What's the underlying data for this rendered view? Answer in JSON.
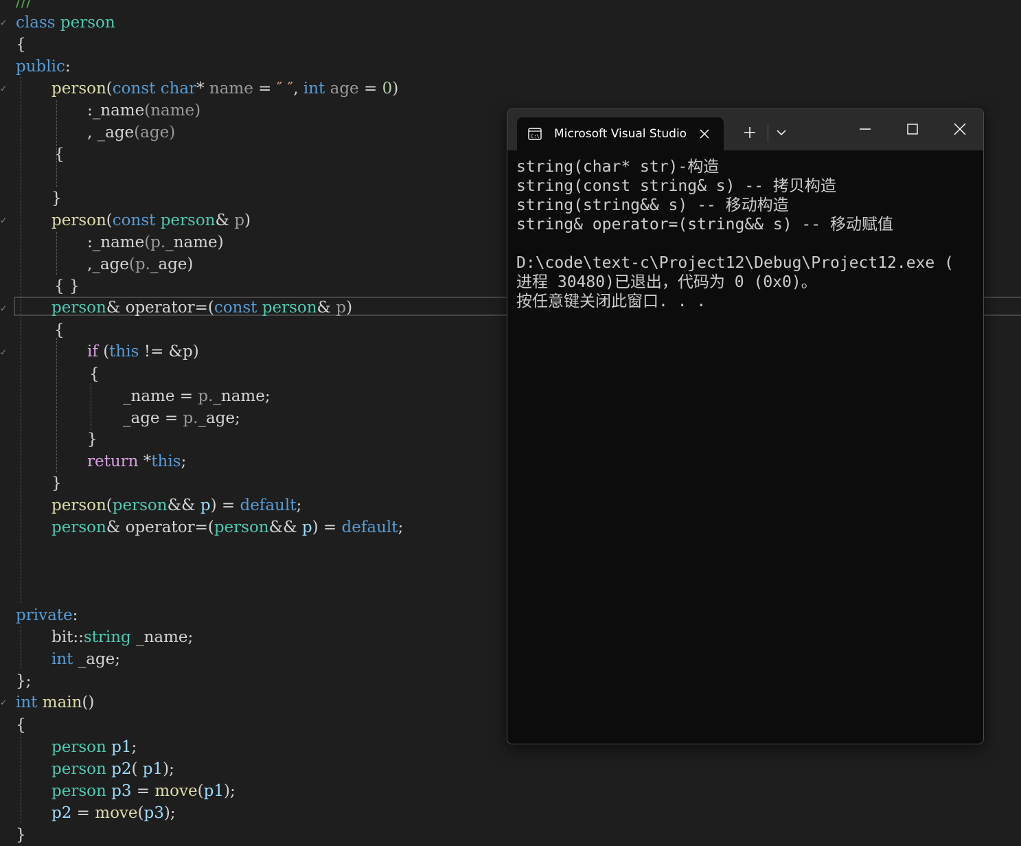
{
  "editor": {
    "lines": [
      [
        {
          "t": "///",
          "c": "cmt"
        }
      ],
      [
        {
          "t": "class ",
          "c": "kw"
        },
        {
          "t": "person",
          "c": "typ"
        }
      ],
      [
        {
          "t": "{",
          "c": "pl"
        }
      ],
      [
        {
          "t": "public",
          "c": "kw"
        },
        {
          "t": ":",
          "c": "pl"
        }
      ],
      [
        {
          "t": "person",
          "c": "fn"
        },
        {
          "t": "(",
          "c": "pl"
        },
        {
          "t": "const ",
          "c": "kw"
        },
        {
          "t": "char",
          "c": "kw"
        },
        {
          "t": "* ",
          "c": "pl"
        },
        {
          "t": "name",
          "c": "prm"
        },
        {
          "t": " = ",
          "c": "pl"
        },
        {
          "t": "″ ″",
          "c": "str"
        },
        {
          "t": ", ",
          "c": "pl"
        },
        {
          "t": "int ",
          "c": "kw"
        },
        {
          "t": "age",
          "c": "prm"
        },
        {
          "t": " = ",
          "c": "pl"
        },
        {
          "t": "0",
          "c": "num"
        },
        {
          "t": ")",
          "c": "pl"
        }
      ],
      [
        {
          "t": ":",
          "c": "pl"
        },
        {
          "t": "_name",
          "c": "pl"
        },
        {
          "t": "(",
          "c": "prm"
        },
        {
          "t": "name",
          "c": "prm"
        },
        {
          "t": ")",
          "c": "prm"
        }
      ],
      [
        {
          "t": ", ",
          "c": "pl"
        },
        {
          "t": "_age",
          "c": "pl"
        },
        {
          "t": "(age)",
          "c": "prm"
        }
      ],
      [
        {
          "t": "{",
          "c": "pl"
        }
      ],
      [],
      [
        {
          "t": "}",
          "c": "pl"
        }
      ],
      [
        {
          "t": "person",
          "c": "fn"
        },
        {
          "t": "(",
          "c": "pl"
        },
        {
          "t": "const ",
          "c": "kw"
        },
        {
          "t": "person",
          "c": "typ"
        },
        {
          "t": "& ",
          "c": "pl"
        },
        {
          "t": "p",
          "c": "prm"
        },
        {
          "t": ")",
          "c": "pl"
        }
      ],
      [
        {
          "t": ":",
          "c": "pl"
        },
        {
          "t": "_name",
          "c": "pl"
        },
        {
          "t": "(p.",
          "c": "prm"
        },
        {
          "t": "_name",
          "c": "pl"
        },
        {
          "t": ")",
          "c": "pl"
        }
      ],
      [
        {
          "t": ",",
          "c": "pl"
        },
        {
          "t": "_age",
          "c": "pl"
        },
        {
          "t": "(p.",
          "c": "prm"
        },
        {
          "t": "_age",
          "c": "pl"
        },
        {
          "t": ")",
          "c": "pl"
        }
      ],
      [
        {
          "t": "{ }",
          "c": "pl"
        }
      ],
      [
        {
          "t": "person",
          "c": "typ"
        },
        {
          "t": "& ",
          "c": "pl"
        },
        {
          "t": "operator=",
          "c": "pl"
        },
        {
          "t": "(",
          "c": "pl"
        },
        {
          "t": "const ",
          "c": "kw"
        },
        {
          "t": "person",
          "c": "typ"
        },
        {
          "t": "& ",
          "c": "pl"
        },
        {
          "t": "p",
          "c": "prm"
        },
        {
          "t": ")",
          "c": "pl"
        }
      ],
      [
        {
          "t": "{",
          "c": "pl"
        }
      ],
      [
        {
          "t": "if ",
          "c": "ctl"
        },
        {
          "t": "(",
          "c": "pl"
        },
        {
          "t": "this",
          "c": "kw"
        },
        {
          "t": " != &p)",
          "c": "pl"
        }
      ],
      [
        {
          "t": "{",
          "c": "pl"
        }
      ],
      [
        {
          "t": "_name",
          "c": "pl"
        },
        {
          "t": " = ",
          "c": "pl"
        },
        {
          "t": "p.",
          "c": "prm"
        },
        {
          "t": "_name",
          "c": "pl"
        },
        {
          "t": ";",
          "c": "pl"
        }
      ],
      [
        {
          "t": "_age",
          "c": "pl"
        },
        {
          "t": " = ",
          "c": "pl"
        },
        {
          "t": "p.",
          "c": "prm"
        },
        {
          "t": "_age",
          "c": "pl"
        },
        {
          "t": ";",
          "c": "pl"
        }
      ],
      [
        {
          "t": "}",
          "c": "pl"
        }
      ],
      [
        {
          "t": "return ",
          "c": "ctl"
        },
        {
          "t": "*",
          "c": "pl"
        },
        {
          "t": "this",
          "c": "kw"
        },
        {
          "t": ";",
          "c": "pl"
        }
      ],
      [
        {
          "t": "}",
          "c": "pl"
        }
      ],
      [
        {
          "t": "person",
          "c": "fn"
        },
        {
          "t": "(",
          "c": "pl"
        },
        {
          "t": "person",
          "c": "typ"
        },
        {
          "t": "&& ",
          "c": "pl"
        },
        {
          "t": "p",
          "c": "var"
        },
        {
          "t": ")",
          "c": "pl"
        },
        {
          "t": " = ",
          "c": "pl"
        },
        {
          "t": "default",
          "c": "kw"
        },
        {
          "t": ";",
          "c": "pl"
        }
      ],
      [
        {
          "t": "person",
          "c": "typ"
        },
        {
          "t": "& ",
          "c": "pl"
        },
        {
          "t": "operator=",
          "c": "pl"
        },
        {
          "t": "(",
          "c": "pl"
        },
        {
          "t": "person",
          "c": "typ"
        },
        {
          "t": "&& ",
          "c": "pl"
        },
        {
          "t": "p",
          "c": "var"
        },
        {
          "t": ")",
          "c": "pl"
        },
        {
          "t": " = ",
          "c": "pl"
        },
        {
          "t": "default",
          "c": "kw"
        },
        {
          "t": ";",
          "c": "pl"
        }
      ],
      [],
      [],
      [],
      [
        {
          "t": "private",
          "c": "kw"
        },
        {
          "t": ":",
          "c": "pl"
        }
      ],
      [
        {
          "t": "bit",
          "c": "pl"
        },
        {
          "t": "::",
          "c": "pl"
        },
        {
          "t": "string",
          "c": "typ"
        },
        {
          "t": " _name;",
          "c": "pl"
        }
      ],
      [
        {
          "t": "int ",
          "c": "kw"
        },
        {
          "t": "_age;",
          "c": "pl"
        }
      ],
      [
        {
          "t": "};",
          "c": "pl"
        }
      ],
      [
        {
          "t": "int ",
          "c": "kw"
        },
        {
          "t": "main",
          "c": "fn"
        },
        {
          "t": "()",
          "c": "pl"
        }
      ],
      [
        {
          "t": "{",
          "c": "pl"
        }
      ],
      [
        {
          "t": "person",
          "c": "typ"
        },
        {
          "t": " ",
          "c": "pl"
        },
        {
          "t": "p1",
          "c": "var"
        },
        {
          "t": ";",
          "c": "pl"
        }
      ],
      [
        {
          "t": "person",
          "c": "typ"
        },
        {
          "t": " ",
          "c": "pl"
        },
        {
          "t": "p2",
          "c": "var"
        },
        {
          "t": "( ",
          "c": "pl"
        },
        {
          "t": "p1",
          "c": "var"
        },
        {
          "t": ");",
          "c": "pl"
        }
      ],
      [
        {
          "t": "person",
          "c": "typ"
        },
        {
          "t": " ",
          "c": "pl"
        },
        {
          "t": "p3",
          "c": "var"
        },
        {
          "t": " = ",
          "c": "pl"
        },
        {
          "t": "move",
          "c": "fn"
        },
        {
          "t": "(",
          "c": "pl"
        },
        {
          "t": "p1",
          "c": "var"
        },
        {
          "t": ");",
          "c": "pl"
        }
      ],
      [
        {
          "t": "p2",
          "c": "var"
        },
        {
          "t": " = ",
          "c": "pl"
        },
        {
          "t": "move",
          "c": "fn"
        },
        {
          "t": "(",
          "c": "pl"
        },
        {
          "t": "p3",
          "c": "var"
        },
        {
          "t": ");",
          "c": "pl"
        }
      ],
      [
        {
          "t": "}",
          "c": "pl"
        }
      ]
    ]
  },
  "terminal": {
    "tab_title": "Microsoft Visual Studio",
    "tab_icon": "terminal-icon",
    "output_lines": [
      "string(char* str)-构造",
      "string(const string& s) -- 拷贝构造",
      "string(string&& s) -- 移动构造",
      "string& operator=(string&& s) -- 移动赋值",
      "",
      "D:\\code\\text-c\\Project12\\Debug\\Project12.exe (",
      "进程 30480)已退出，代码为 0 (0x0)。",
      "按任意键关闭此窗口. . ."
    ]
  },
  "colors": {
    "editor_bg": "#1e1e1e",
    "keyword": "#569cd6",
    "type": "#4ec9b0",
    "function": "#dcdcaa",
    "control": "#d8a0df",
    "terminal_bg": "#0c0c0c",
    "titlebar_bg": "#2b2b2b"
  }
}
